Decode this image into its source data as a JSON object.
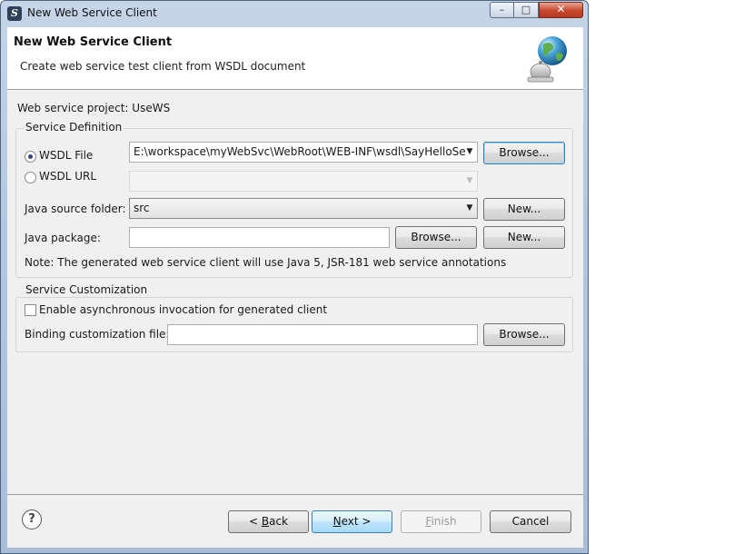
{
  "window": {
    "title": "New Web Service Client"
  },
  "banner": {
    "title": "New Web Service Client",
    "description": "Create web service test client from WSDL document"
  },
  "project_label": "Web service project: UseWS",
  "service_definition": {
    "title": "Service Definition",
    "wsdl_file_label": "WSDL File",
    "wsdl_url_label": "WSDL URL",
    "wsdl_file_value": "E:\\workspace\\myWebSvc\\WebRoot\\WEB-INF\\wsdl\\SayHelloSe",
    "wsdl_url_value": "",
    "browse_label": "Browse...",
    "java_source_label": "Java source folder:",
    "java_source_value": "src",
    "new_label": "New...",
    "java_package_label": "Java package:",
    "java_package_value": "",
    "package_browse_label": "Browse...",
    "package_new_label": "New...",
    "note": "Note: The generated web service client will use Java 5, JSR-181 web service annotations"
  },
  "service_customization": {
    "title": "Service Customization",
    "async_label": "Enable asynchronous invocation for generated client",
    "binding_label": "Binding customization file:",
    "binding_value": "",
    "browse_label": "Browse..."
  },
  "footer": {
    "help_glyph": "?",
    "back_prefix": "< ",
    "back_mnemonic": "B",
    "back_rest": "ack",
    "next_mnemonic": "N",
    "next_rest": "ext >",
    "finish_mnemonic": "F",
    "finish_rest": "inish",
    "cancel_label": "Cancel"
  },
  "icons": {
    "app": "myeclipse-app-icon",
    "wizard": "globe-web-service-icon",
    "help": "help-icon"
  },
  "colors": {
    "titlebar": "#b4c7de",
    "close_button": "#c8472d",
    "dialog_bg": "#f0f0f0",
    "default_button": "#a7d9f5"
  }
}
